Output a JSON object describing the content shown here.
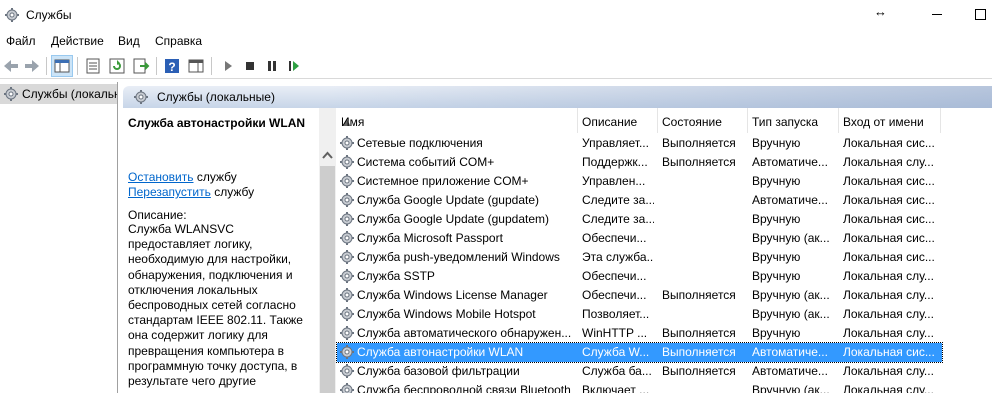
{
  "window": {
    "title": "Службы"
  },
  "menu": [
    "Файл",
    "Действие",
    "Вид",
    "Справка"
  ],
  "toolbar": {
    "icons": [
      "back-arrow-icon",
      "forward-arrow-icon",
      "show-hide-tree-icon",
      "properties-icon",
      "refresh-icon",
      "export-list-icon",
      "help-icon",
      "show-hide-action-pane-icon",
      "start-service-icon",
      "stop-service-icon",
      "pause-service-icon",
      "restart-service-icon"
    ]
  },
  "tree": {
    "item": "Службы (локальные)"
  },
  "pane": {
    "header": "Службы (локальные)"
  },
  "details": {
    "service_title": "Служба автонастройки WLAN",
    "stop_link": "Остановить",
    "stop_suffix": " службу",
    "restart_link": "Перезапустить",
    "restart_suffix": " службу",
    "description_label": "Описание:",
    "description_text": "Служба WLANSVC предоставляет логику, необходимую для настройки, обнаружения, подключения и отключения локальных беспроводных сетей согласно стандартам IEEE 802.11. Также она содержит логику для превращения компьютера в программную точку доступа, в результате чего другие"
  },
  "columns": [
    "Имя",
    "Описание",
    "Состояние",
    "Тип запуска",
    "Вход от имени"
  ],
  "rows": [
    {
      "name": "Сетевые подключения",
      "desc": "Управляет...",
      "state": "Выполняется",
      "start": "Вручную",
      "logon": "Локальная сис..."
    },
    {
      "name": "Система событий COM+",
      "desc": "Поддержк...",
      "state": "Выполняется",
      "start": "Автоматиче...",
      "logon": "Локальная слу..."
    },
    {
      "name": "Системное приложение COM+",
      "desc": "Управлен...",
      "state": "",
      "start": "Вручную",
      "logon": "Локальная сис..."
    },
    {
      "name": "Служба Google Update (gupdate)",
      "desc": "Следите за...",
      "state": "",
      "start": "Автоматиче...",
      "logon": "Локальная сис..."
    },
    {
      "name": "Служба Google Update (gupdatem)",
      "desc": "Следите за...",
      "state": "",
      "start": "Вручную",
      "logon": "Локальная сис..."
    },
    {
      "name": "Служба Microsoft Passport",
      "desc": "Обеспечи...",
      "state": "",
      "start": "Вручную (ак...",
      "logon": "Локальная сис..."
    },
    {
      "name": "Служба push-уведомлений Windows",
      "desc": "Эта служба...",
      "state": "",
      "start": "Вручную",
      "logon": "Локальная сис..."
    },
    {
      "name": "Служба SSTP",
      "desc": "Обеспечи...",
      "state": "",
      "start": "Вручную",
      "logon": "Локальная слу..."
    },
    {
      "name": "Служба Windows License Manager",
      "desc": "Обеспечи...",
      "state": "Выполняется",
      "start": "Вручную (ак...",
      "logon": "Локальная слу..."
    },
    {
      "name": "Служба Windows Mobile Hotspot",
      "desc": "Позволяет...",
      "state": "",
      "start": "Вручную (ак...",
      "logon": "Локальная слу..."
    },
    {
      "name": "Служба автоматического обнаружен...",
      "desc": "WinHTTP ...",
      "state": "Выполняется",
      "start": "Вручную",
      "logon": "Локальная слу..."
    },
    {
      "name": "Служба автонастройки WLAN",
      "desc": "Служба W...",
      "state": "Выполняется",
      "start": "Автоматиче...",
      "logon": "Локальная сис...",
      "selected": true
    },
    {
      "name": "Служба базовой фильтрации",
      "desc": "Служба ба...",
      "state": "Выполняется",
      "start": "Автоматиче...",
      "logon": "Локальная слу..."
    },
    {
      "name": "Служба беспроводной связи Bluetooth",
      "desc": "Включает ...",
      "state": "",
      "start": "Вручную (ак...",
      "logon": "Локальная слу..."
    }
  ]
}
